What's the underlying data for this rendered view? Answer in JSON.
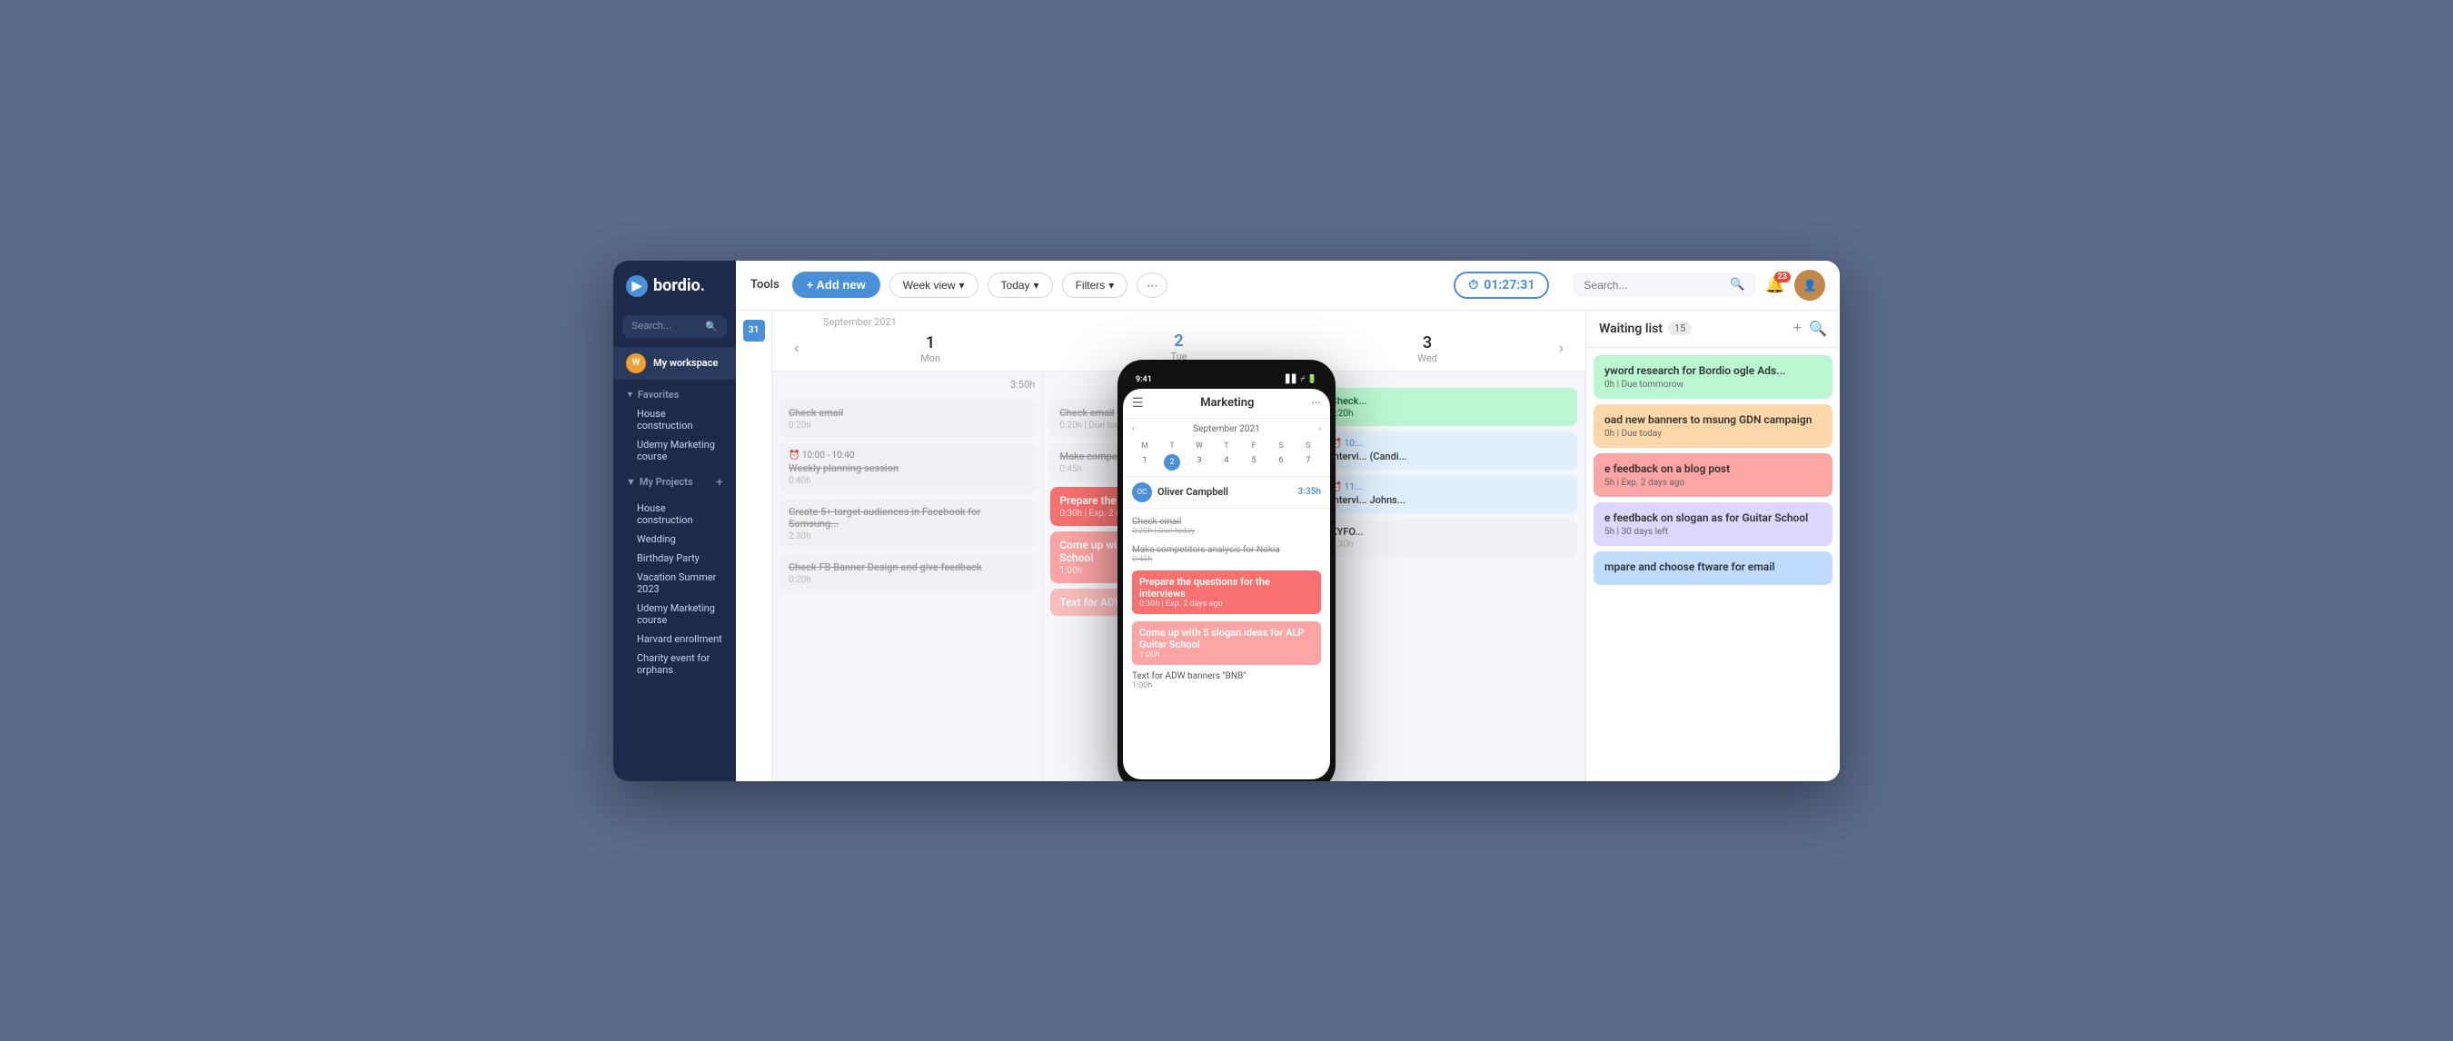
{
  "app": {
    "logo_text": "bordio.",
    "logo_icon": "▶"
  },
  "sidebar": {
    "search_placeholder": "Search...",
    "workspace_name": "My workspace",
    "favorites_label": "Favorites",
    "favorites_items": [
      {
        "label": "House construction"
      },
      {
        "label": "Udemy Marketing course"
      }
    ],
    "projects_label": "My Projects",
    "projects_items": [
      {
        "label": "House construction"
      },
      {
        "label": "Wedding"
      },
      {
        "label": "Birthday Party"
      },
      {
        "label": "Vacation Summer 2023"
      },
      {
        "label": "Udemy Marketing course"
      },
      {
        "label": "Harvard enrollment"
      },
      {
        "label": "Charity event for orphans"
      }
    ]
  },
  "toolbar": {
    "tools_label": "Tools",
    "add_new_label": "+ Add new",
    "week_view_label": "Week view",
    "today_label": "Today",
    "filters_label": "Filters",
    "more_label": "···",
    "timer_value": "01:27:31",
    "search_placeholder": "Search...",
    "notification_count": "23"
  },
  "calendar": {
    "month_label": "September 2021",
    "days": [
      {
        "num": "1",
        "name": "Mon",
        "active": false,
        "total": "3:50h"
      },
      {
        "num": "2",
        "name": "Tue",
        "active": true,
        "total": "3:35h"
      },
      {
        "num": "3",
        "name": "Wed",
        "active": false,
        "total": ""
      }
    ],
    "mon_tasks": [
      {
        "title": "Check email",
        "meta": "0:20h",
        "type": "strikethrough"
      },
      {
        "title": "10:00 - 10:40",
        "subtitle": "Weekly planning session",
        "meta": "0:40h",
        "type": "strikethrough"
      },
      {
        "title": "Create 5+ target audiences in Facebook for Samsung...",
        "meta": "2:30h",
        "type": "strikethrough"
      },
      {
        "title": "Check FB Banner Design and give feedback",
        "meta": "0:20h",
        "type": "strikethrough"
      }
    ],
    "tue_tasks": [
      {
        "title": "Check email",
        "meta": "0:20h | Due today",
        "type": "strikethrough"
      },
      {
        "title": "Make competitors analysis for Nokia",
        "meta": "0:45h",
        "type": "strikethrough"
      },
      {
        "title": "Prepare the questions for the interviews",
        "meta": "0:30h | Exp. 2 days ago",
        "type": "active-red"
      },
      {
        "title": "Come up with 5 slogan ideas for ALP Guitar School",
        "meta": "1:00h",
        "type": "active-salmon"
      },
      {
        "title": "Text for ADW banners \"BNB\"",
        "meta": "",
        "type": "active-salmon-partial"
      }
    ],
    "wed_tasks": [
      {
        "title": "Check...",
        "meta": "0:20h",
        "type": "green-light"
      },
      {
        "title": "10: ...",
        "subtitle": "Intervi... (Candi...",
        "meta": "",
        "type": "normal"
      },
      {
        "title": "11:...",
        "subtitle": "Intervi... Johns...",
        "meta": "",
        "type": "normal"
      },
      {
        "title": "KYFO...",
        "meta": "1:30h",
        "type": "normal"
      }
    ]
  },
  "waiting_list": {
    "title": "Waiting list",
    "count": "15",
    "items": [
      {
        "title": "yword research for Bordio ogle Ads...",
        "meta": "0h | Due tommorow",
        "color": "green"
      },
      {
        "title": "oad new banners to msung GDN campaign",
        "meta": "0h | Due today",
        "color": "orange"
      },
      {
        "title": "e feedback on a blog post",
        "meta": "5h | Exp. 2 days ago",
        "color": "red"
      },
      {
        "title": "e feedback on slogan as for Guitar School",
        "meta": "5h | 30 days left",
        "color": "purple"
      },
      {
        "title": "mpare and choose ftware for email",
        "meta": "",
        "color": "blue"
      }
    ]
  },
  "phone": {
    "time": "9:41",
    "title": "Marketing",
    "cal_title": "September 2021",
    "user_name": "Oliver Campbell",
    "user_time": "3:35h",
    "tasks": [
      {
        "title": "Check email",
        "meta": "0:20h | Due today",
        "type": "strikethrough"
      },
      {
        "title": "Make competitors analysis for Nokia",
        "meta": "0:45h",
        "type": "strikethrough"
      },
      {
        "title": "Prepare the questions for the interviews",
        "meta": "0:30h | Exp. 2 days ago",
        "type": "active-red"
      },
      {
        "title": "Come up with 5 slogan ideas for ALP Guitar School",
        "meta": "1:00h",
        "type": "active-salmon"
      },
      {
        "title": "Text for ADW banners \"BNB\"",
        "meta": "1:00h",
        "type": "text"
      }
    ]
  }
}
